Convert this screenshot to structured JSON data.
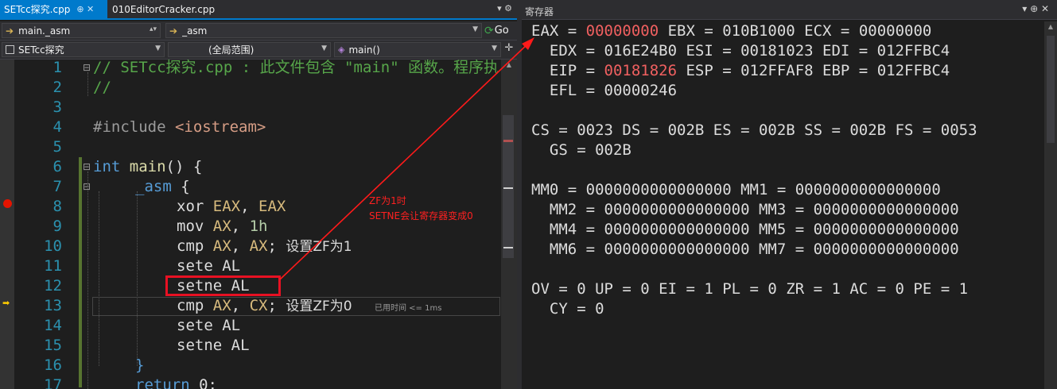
{
  "tabs": [
    {
      "label": "SETcc探究.cpp",
      "controls": "⊕ ✕"
    },
    {
      "label": "010EditorCracker.cpp"
    }
  ],
  "tabbar_overflow": "▾ ⚙",
  "navbar": {
    "row1": {
      "left": "main._asm",
      "mid": "_asm",
      "go": "Go"
    },
    "row2": {
      "left": "SETcc探究",
      "mid": "(全局范围)",
      "right": "main()"
    }
  },
  "line_numbers": [
    "1",
    "2",
    "3",
    "4",
    "5",
    "6",
    "7",
    "8",
    "9",
    "10",
    "11",
    "12",
    "13",
    "14",
    "15",
    "16",
    "17"
  ],
  "code": {
    "l1": "// SETcc探究.cpp : 此文件包含 \"main\" 函数。程序执",
    "l2": "//",
    "l4_kw": "#include",
    "l4_str": " <iostream>",
    "l6_kw": "int",
    "l6_fn": " main",
    "l6_rest": "() {",
    "l7_kw": "_asm",
    "l7_rest": " {",
    "l8_op": "xor",
    "l8_a": "EAX",
    "l8_b": "EAX",
    "l9_op": "mov",
    "l9_a": "AX",
    "l9_b": "1h",
    "l10_op": "cmp",
    "l10_a": "AX",
    "l10_b": "AX",
    "l10_cmt": "设置ZF为1",
    "l11": "sete AL",
    "l12": "setne AL",
    "l13_op": "cmp",
    "l13_a": "AX",
    "l13_b": "CX",
    "l13_cmt": "设置ZF为0",
    "l14": "sete AL",
    "l15": "setne AL",
    "l16": "}",
    "l17_kw": "return",
    "l17_rest": " 0;"
  },
  "elapsed_hint": "已用时间 <= 1ms",
  "annotation": {
    "line1": "ZF为1时",
    "line2": "SETNE会让寄存器变成0"
  },
  "registers_window": {
    "title": "寄存器",
    "controls": "▾ ⊕ ✕",
    "eax_label": "EAX = ",
    "eax_value": "00000000",
    "line1_rest": " EBX = 010B1000 ECX = 00000000",
    "line2": "  EDX = 016E24B0 ESI = 00181023 EDI = 012FFBC4",
    "eip_label": "  EIP = ",
    "eip_value": "00181826",
    "line3_rest": " ESP = 012FFAF8 EBP = 012FFBC4",
    "line4": "  EFL = 00000246",
    "line6": "CS = 0023 DS = 002B ES = 002B SS = 002B FS = 0053",
    "line7": "  GS = 002B",
    "line9": "MM0 = 0000000000000000 MM1 = 0000000000000000",
    "line10": "  MM2 = 0000000000000000 MM3 = 0000000000000000",
    "line11": "  MM4 = 0000000000000000 MM5 = 0000000000000000",
    "line12": "  MM6 = 0000000000000000 MM7 = 0000000000000000",
    "line14": "OV = 0 UP = 0 EI = 1 PL = 0 ZR = 1 AC = 0 PE = 1",
    "line15": "  CY = 0"
  },
  "colors": {
    "accent": "#007acc",
    "changed_value": "#f06060",
    "annotation_red": "#ff2020",
    "breakpoint": "#e51400"
  }
}
